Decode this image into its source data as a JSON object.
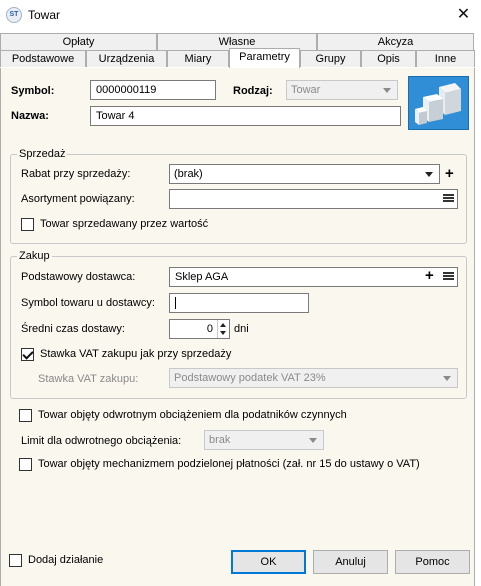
{
  "window": {
    "title": "Towar",
    "app_icon": "app-icon",
    "close_glyph": "✕"
  },
  "tabs": {
    "row1": [
      {
        "label": "Opłaty"
      },
      {
        "label": "Własne"
      },
      {
        "label": "Akcyza"
      }
    ],
    "row2": [
      {
        "label": "Podstawowe"
      },
      {
        "label": "Urządzenia"
      },
      {
        "label": "Miary"
      },
      {
        "label": "Parametry",
        "active": true
      },
      {
        "label": "Grupy"
      },
      {
        "label": "Opis"
      },
      {
        "label": "Inne"
      }
    ]
  },
  "header": {
    "symbol_label": "Symbol:",
    "symbol_value": "0000000119",
    "rodzaj_label": "Rodzaj:",
    "rodzaj_value": "Towar",
    "nazwa_label": "Nazwa:",
    "nazwa_value": "Towar 4",
    "product_image_icon": "product-boxes-icon"
  },
  "sprzedaz": {
    "title": "Sprzedaż",
    "rabat_label": "Rabat przy sprzedaży:",
    "rabat_value": "(brak)",
    "plus_glyph": "+",
    "asortyment_label": "Asortyment powiązany:",
    "asortyment_value": "",
    "wartosc_label": "Towar sprzedawany przez wartość",
    "wartosc_checked": false
  },
  "zakup": {
    "title": "Zakup",
    "dostawca_label": "Podstawowy dostawca:",
    "dostawca_value": "Sklep AGA",
    "plus_glyph": "+",
    "symbol_dostawcy_label": "Symbol towaru u dostawcy:",
    "symbol_dostawcy_value": "",
    "czas_label": "Średni czas dostawy:",
    "czas_value": "0",
    "czas_unit": "dni",
    "vat_jak_sprzedaz_label": "Stawka VAT zakupu jak przy sprzedaży",
    "vat_jak_sprzedaz_checked": true,
    "vat_label": "Stawka VAT zakupu:",
    "vat_value": "Podstawowy podatek VAT 23%"
  },
  "odwrotne": {
    "label": "Towar objęty odwrotnym obciążeniem dla podatników czynnych",
    "checked": false,
    "limit_label": "Limit dla odwrotnego obciążenia:",
    "limit_value": "brak"
  },
  "mpp": {
    "label": "Towar objęty mechanizmem podzielonej płatności (zał. nr 15 do ustawy o VAT)",
    "checked": false
  },
  "footer": {
    "dodaj_label": "Dodaj działanie",
    "dodaj_checked": false,
    "ok_label": "OK",
    "anuluj_label": "Anuluj",
    "pomoc_label": "Pomoc"
  }
}
